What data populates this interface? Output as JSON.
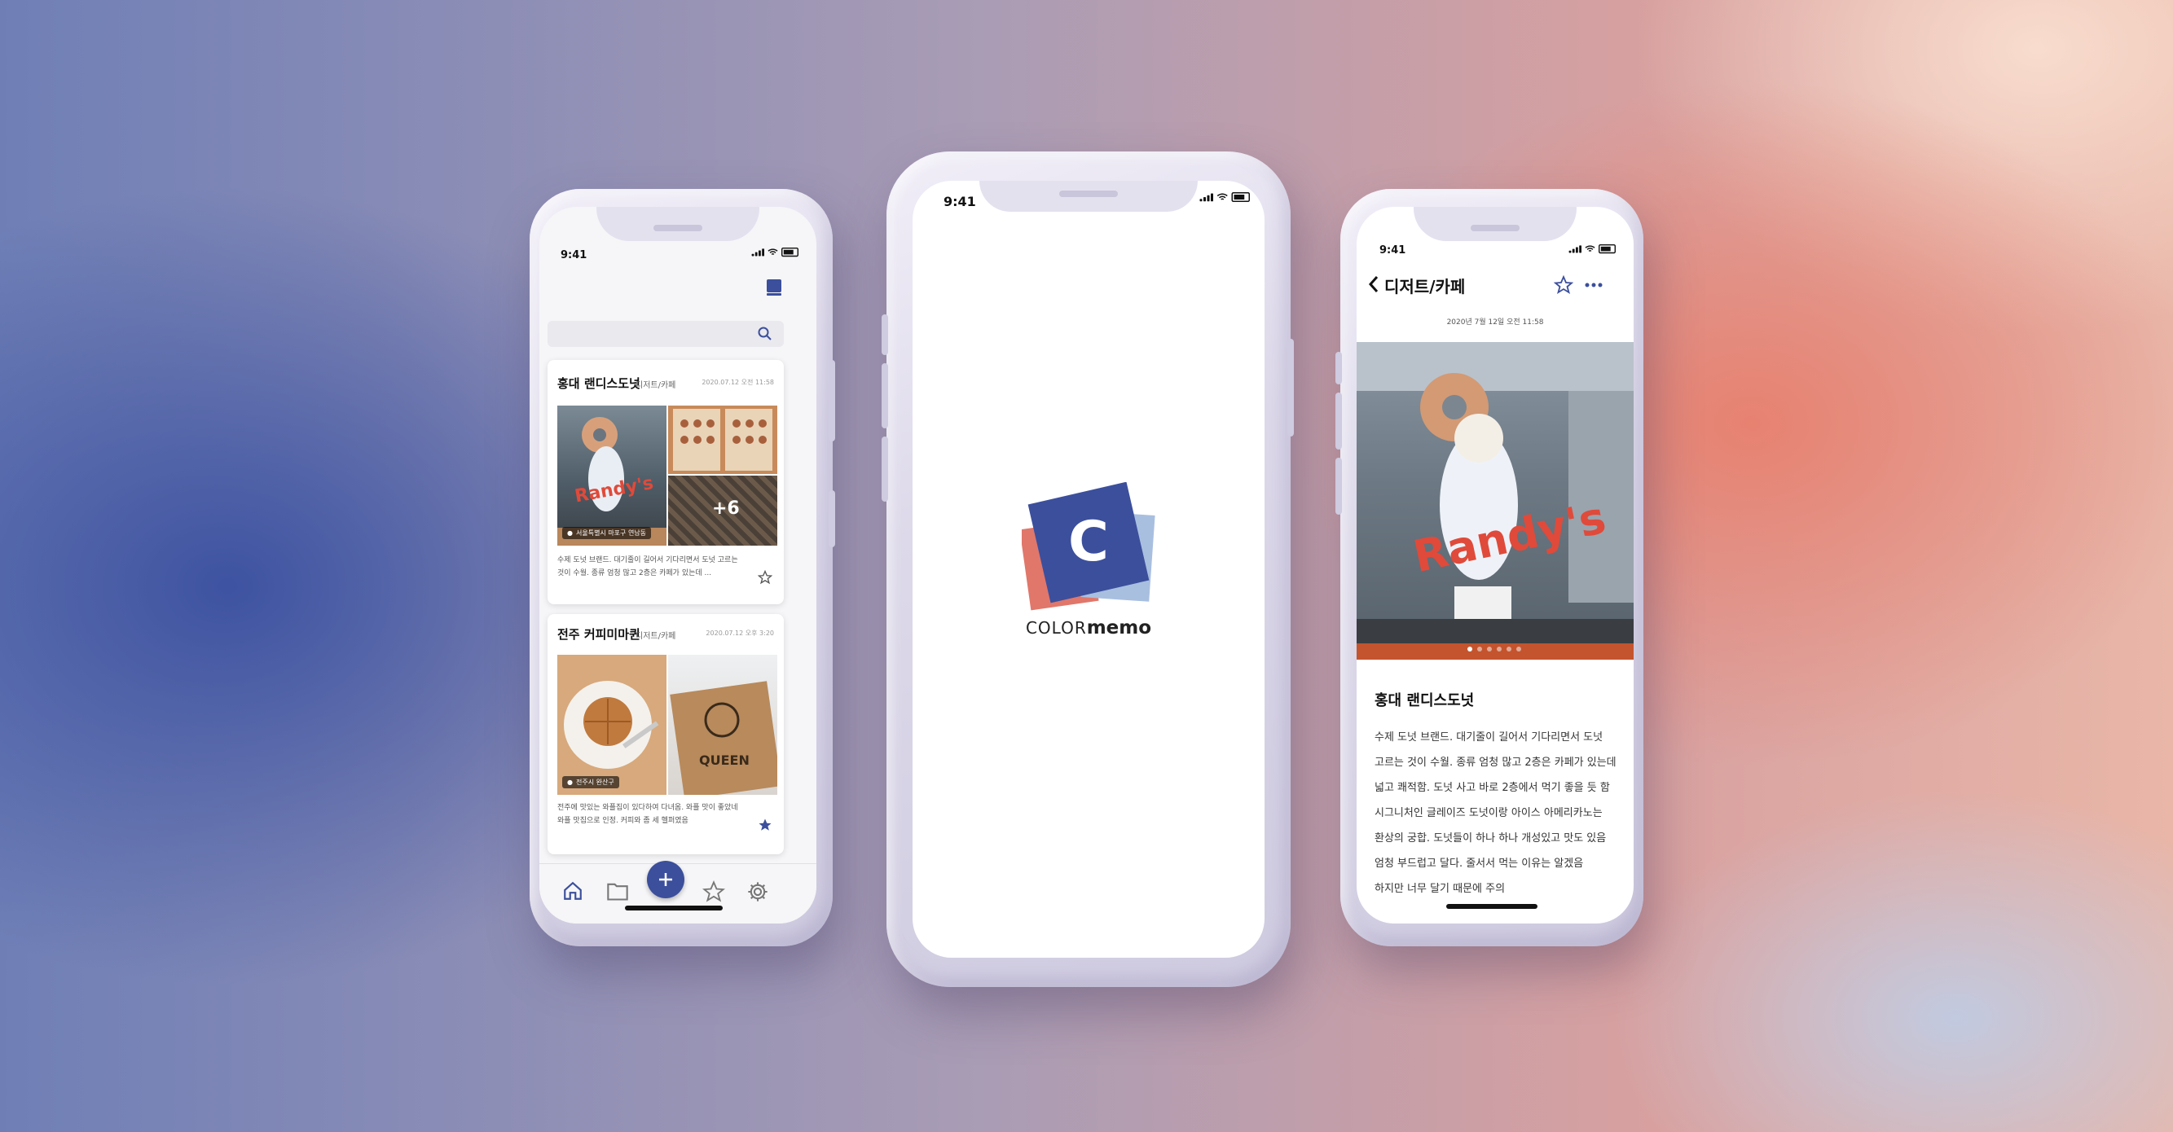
{
  "status_time": "9:41",
  "left_phone": {
    "search_placeholder": "",
    "memos": [
      {
        "title": "홍대 랜디스도넛",
        "category": "디저트/카페",
        "date": "2020.07.12 오전 11:58",
        "location": "서울특별시 마포구 연남동",
        "extra_photos": "+6",
        "text_line1": "수제 도넛 브랜드. 대기줄이 길어서 기다리면서 도넛 고르는",
        "text_line2": "것이 수월. 종류 엄청 많고 2층은 카페가 있는데 ...",
        "starred": false
      },
      {
        "title": "전주 커피미마퀸",
        "category": "디저트/카페",
        "date": "2020.07.12 오후 3:20",
        "location": "전주시 완산구",
        "text_line1": "전주에 맛있는 와플집이 있다하여 다녀옴. 와플 맛이 좋았네",
        "text_line2": "와플 맛집으로 인정. 커피와 좀 세 헬퍼였음",
        "starred": true
      }
    ]
  },
  "center_phone": {
    "logo_letter": "C",
    "brand_color_word": "COLOR",
    "brand_memo_word": "memo"
  },
  "right_phone": {
    "header_title": "디저트/카페",
    "date": "2020년 7월 12일 오전 11:58",
    "memo_title": "홍대 랜디스도넛",
    "body_lines": [
      "수제 도넛 브랜드. 대기줄이 길어서 기다리면서 도넛",
      "고르는 것이 수월. 종류 엄청 많고 2층은 카페가 있는데",
      "넓고 쾌적함. 도넛 사고 바로 2층에서 먹기 좋을 듯 함",
      "시그니처인 글레이즈 도넛이랑 아이스 아메리카노는",
      "환상의 궁합. 도넛들이 하나 하나 개성있고 맛도 있음",
      "엄청 부드럽고 달다. 줄서서 먹는 이유는 알겠음",
      "하지만 너무 달기 때문에 주의"
    ]
  },
  "colors": {
    "brand_blue": "#3c4f9c",
    "brand_coral": "#e0776a",
    "brand_light_blue": "#a9bfe0"
  }
}
